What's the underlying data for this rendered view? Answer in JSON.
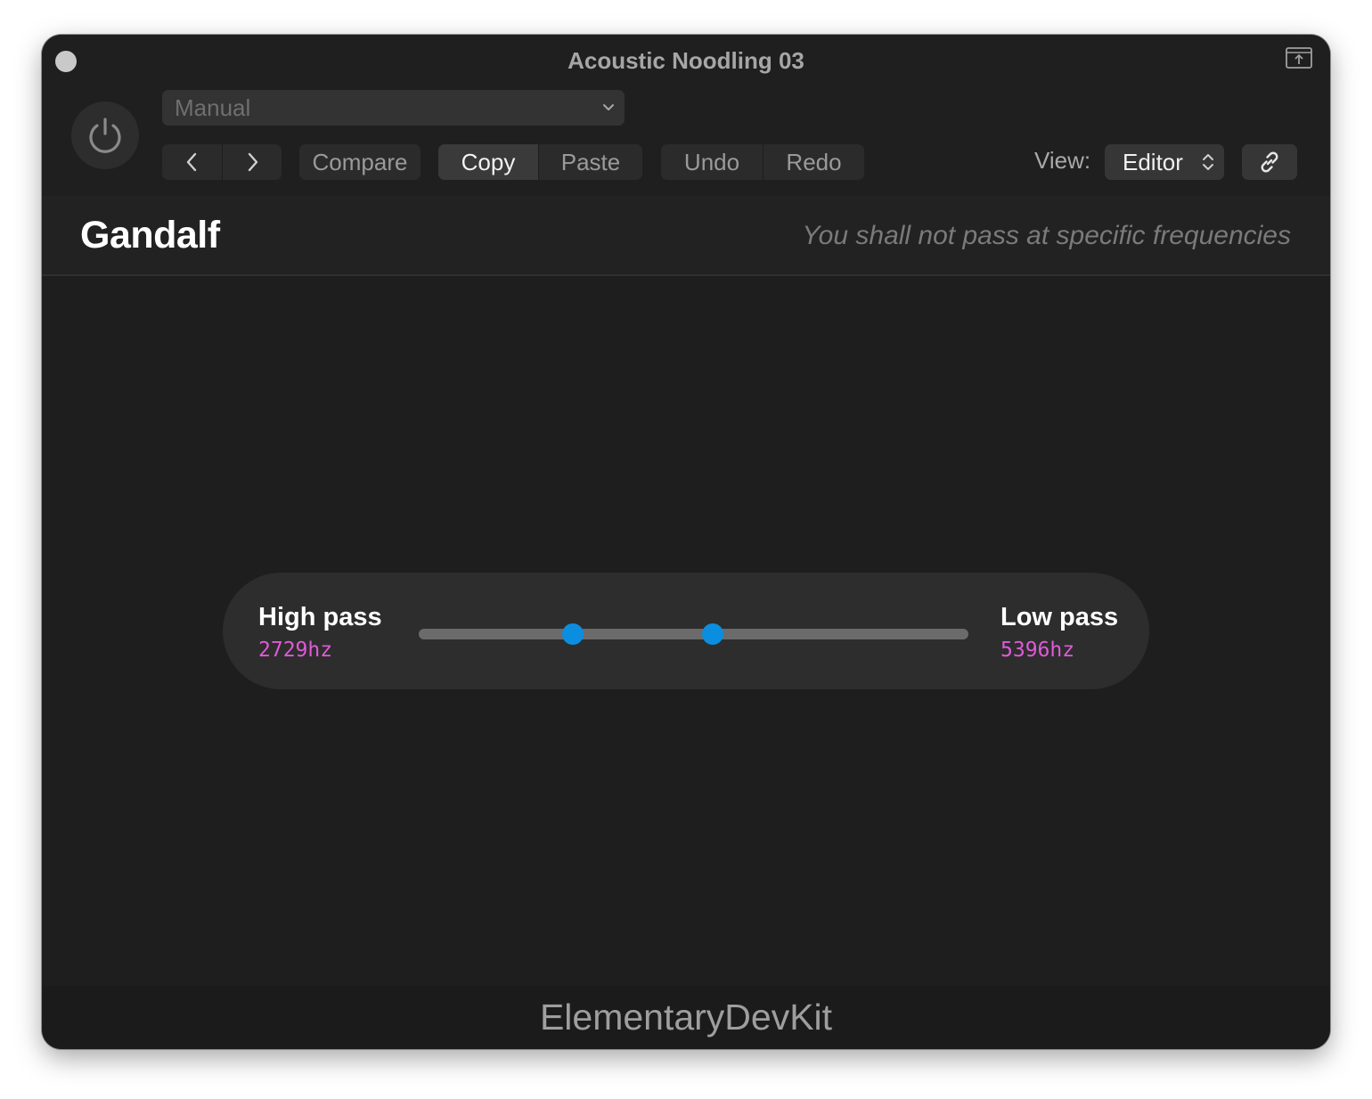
{
  "window": {
    "title": "Acoustic Noodling 03"
  },
  "toolbar": {
    "preset": "Manual",
    "compare_label": "Compare",
    "copy_label": "Copy",
    "paste_label": "Paste",
    "undo_label": "Undo",
    "redo_label": "Redo",
    "view_label": "View:",
    "view_value": "Editor"
  },
  "plugin": {
    "name": "Gandalf",
    "tagline": "You shall not pass at specific frequencies"
  },
  "filter": {
    "high_pass_label": "High pass",
    "high_pass_value": "2729hz",
    "high_pass_position": 0.28,
    "low_pass_label": "Low pass",
    "low_pass_value": "5396hz",
    "low_pass_position": 0.535,
    "accent_color": "#0b8ee0",
    "value_color": "#e05ad8"
  },
  "footer": {
    "brand": "ElementaryDevKit"
  },
  "icons": {
    "close": "circle-dot",
    "pip": "window-upload-icon",
    "power": "power-icon",
    "dropdown": "chevron-down-icon",
    "prev": "chevron-left-icon",
    "next": "chevron-right-icon",
    "view_select": "updown-chevron-icon",
    "link": "link-icon"
  }
}
